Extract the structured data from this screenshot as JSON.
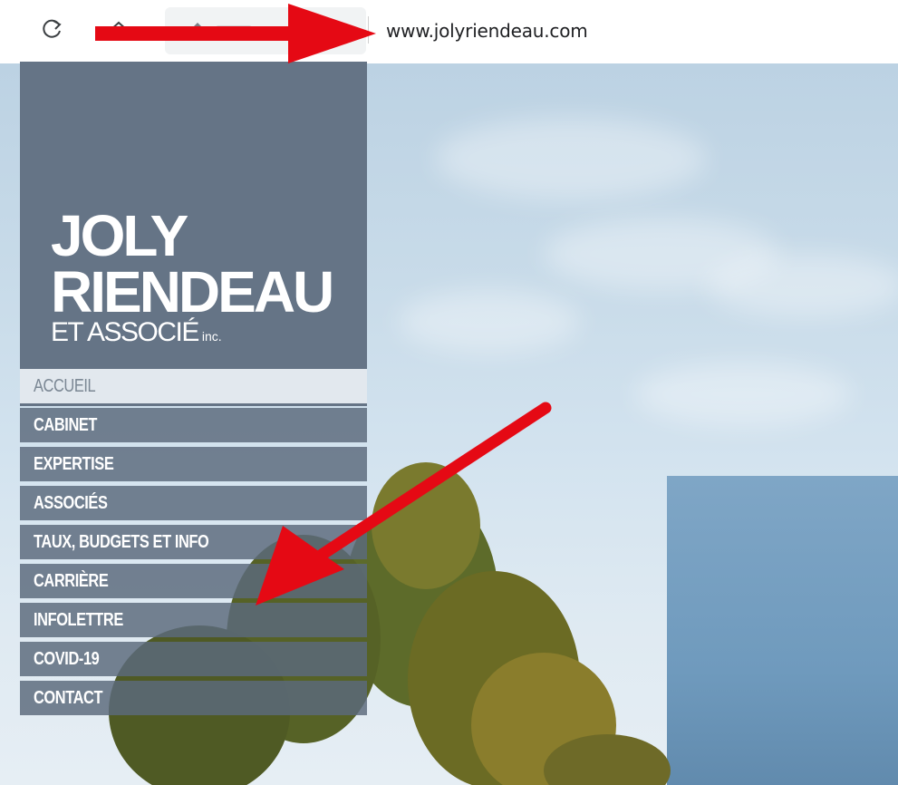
{
  "browser": {
    "url": "www.jolyriendeau.com",
    "icons": {
      "reload": "reload-icon",
      "home": "home-icon"
    }
  },
  "logo": {
    "line1": "JOLY",
    "line2": "RIENDEAU",
    "line3": "ET ASSOCIÉ",
    "suffix": "inc."
  },
  "nav": {
    "items": [
      {
        "label": "ACCUEIL",
        "active": true
      },
      {
        "label": "CABINET"
      },
      {
        "label": "EXPERTISE"
      },
      {
        "label": "ASSOCIÉS"
      },
      {
        "label": "TAUX, BUDGETS ET INFO"
      },
      {
        "label": "CARRIÈRE"
      },
      {
        "label": "INFOLETTRE"
      },
      {
        "label": "COVID-19"
      },
      {
        "label": "CONTACT"
      }
    ]
  },
  "colors": {
    "logo_bg": "#657486",
    "nav_bg": "#5c6a7c",
    "annotation_arrow": "#e50914"
  }
}
